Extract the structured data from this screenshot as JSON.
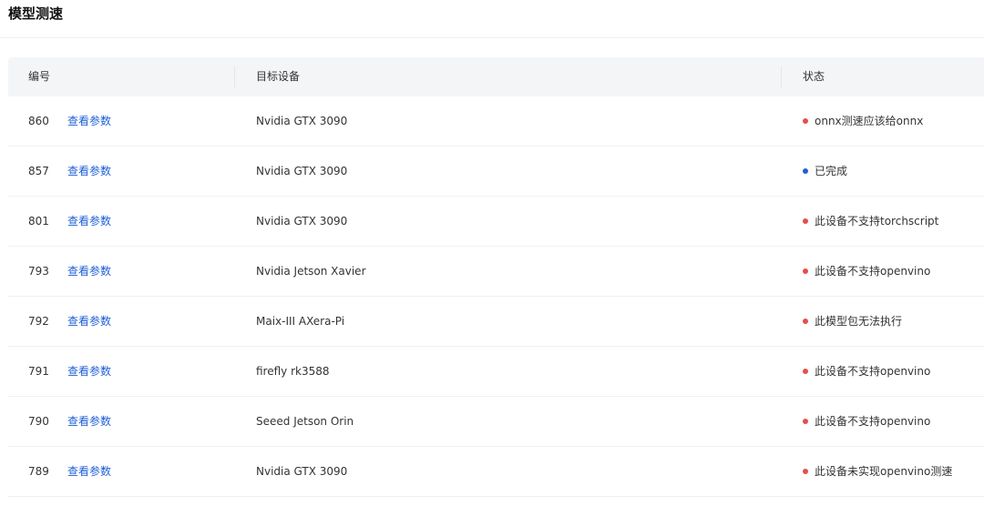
{
  "page": {
    "title": "模型测速"
  },
  "table": {
    "headers": {
      "id": "编号",
      "device": "目标设备",
      "status": "状态"
    },
    "rows": [
      {
        "id": "860",
        "action": "查看参数",
        "device": "Nvidia GTX 3090",
        "status": "onnx测速应该给onnx",
        "status_color": "#e84d4d"
      },
      {
        "id": "857",
        "action": "查看参数",
        "device": "Nvidia GTX 3090",
        "status": "已完成",
        "status_color": "#1e5fd6"
      },
      {
        "id": "801",
        "action": "查看参数",
        "device": "Nvidia GTX 3090",
        "status": "此设备不支持torchscript",
        "status_color": "#e84d4d"
      },
      {
        "id": "793",
        "action": "查看参数",
        "device": "Nvidia Jetson Xavier",
        "status": "此设备不支持openvino",
        "status_color": "#e84d4d"
      },
      {
        "id": "792",
        "action": "查看参数",
        "device": "Maix-III AXera-Pi",
        "status": "此模型包无法执行",
        "status_color": "#e84d4d"
      },
      {
        "id": "791",
        "action": "查看参数",
        "device": "firefly rk3588",
        "status": "此设备不支持openvino",
        "status_color": "#e84d4d"
      },
      {
        "id": "790",
        "action": "查看参数",
        "device": "Seeed Jetson Orin",
        "status": "此设备不支持openvino",
        "status_color": "#e84d4d"
      },
      {
        "id": "789",
        "action": "查看参数",
        "device": "Nvidia GTX 3090",
        "status": "此设备未实现openvino测速",
        "status_color": "#e84d4d"
      }
    ]
  }
}
